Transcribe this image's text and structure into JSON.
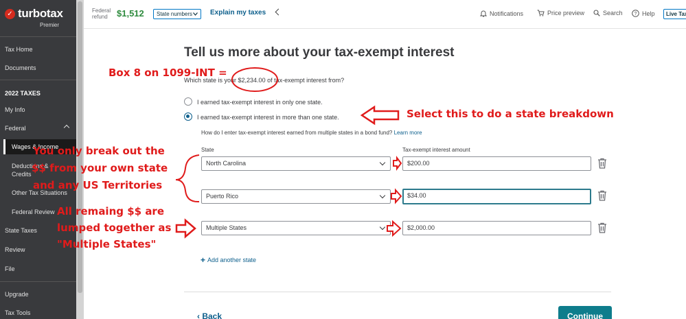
{
  "sidebar": {
    "brand": "turbotax",
    "edition": "Premier",
    "items": {
      "tax_home": "Tax Home",
      "documents": "Documents",
      "taxes_heading": "2022 TAXES",
      "my_info": "My Info",
      "federal": "Federal",
      "wages": "Wages & Income",
      "deductions": "Deductions &",
      "credits": "Credits",
      "other": "Other Tax Situations",
      "federal_review": "Federal Review",
      "state_taxes": "State Taxes",
      "review": "Review",
      "file": "File",
      "upgrade": "Upgrade",
      "tax_tools": "Tax Tools"
    }
  },
  "header": {
    "federal_refund_line1": "Federal",
    "federal_refund_line2": "refund",
    "refund_amount": "$1,512",
    "state_numbers": "State numbers",
    "explain": "Explain my taxes",
    "notifications": "Notifications",
    "price_preview": "Price preview",
    "search": "Search",
    "help": "Help",
    "live_tax": "Live Tax"
  },
  "main": {
    "title": "Tell us more about your tax-exempt interest",
    "question_pre": "Which state is your ",
    "question_amount": "$2,234.00",
    "question_post": " of tax-exempt interest from?",
    "option_one": "I earned tax-exempt interest in only one state.",
    "option_multi": "I earned tax-exempt interest in more than one state.",
    "help_text": "How do I enter tax-exempt interest earned from multiple states in a bond fund?",
    "learn_more": "Learn more",
    "col_state": "State",
    "col_amount": "Tax-exempt interest amount",
    "rows": [
      {
        "state": "North Carolina",
        "amount": "$200.00"
      },
      {
        "state": "Puerto Rico",
        "amount": "$34.00"
      },
      {
        "state": "Multiple States",
        "amount": "$2,000.00"
      }
    ],
    "add_state": "Add another state",
    "back": "Back",
    "continue": "Continue"
  },
  "annotations": {
    "box8": "Box 8 on 1099-INT =",
    "select_this": "Select this to do a state breakdown",
    "break_out_1": "You only break out the",
    "break_out_2": "$$ from your own state",
    "break_out_3": "and any US Territories",
    "remaining_1": "All remaing $$ are",
    "remaining_2": "lumped together as",
    "remaining_3": "\"Multiple States\"",
    "color": "#e01b1b"
  },
  "colors": {
    "sidebar_bg": "#393a3d",
    "accent": "#0d5f8c",
    "refund_green": "#2e8b3e",
    "continue_bg": "#0e7d8c"
  }
}
